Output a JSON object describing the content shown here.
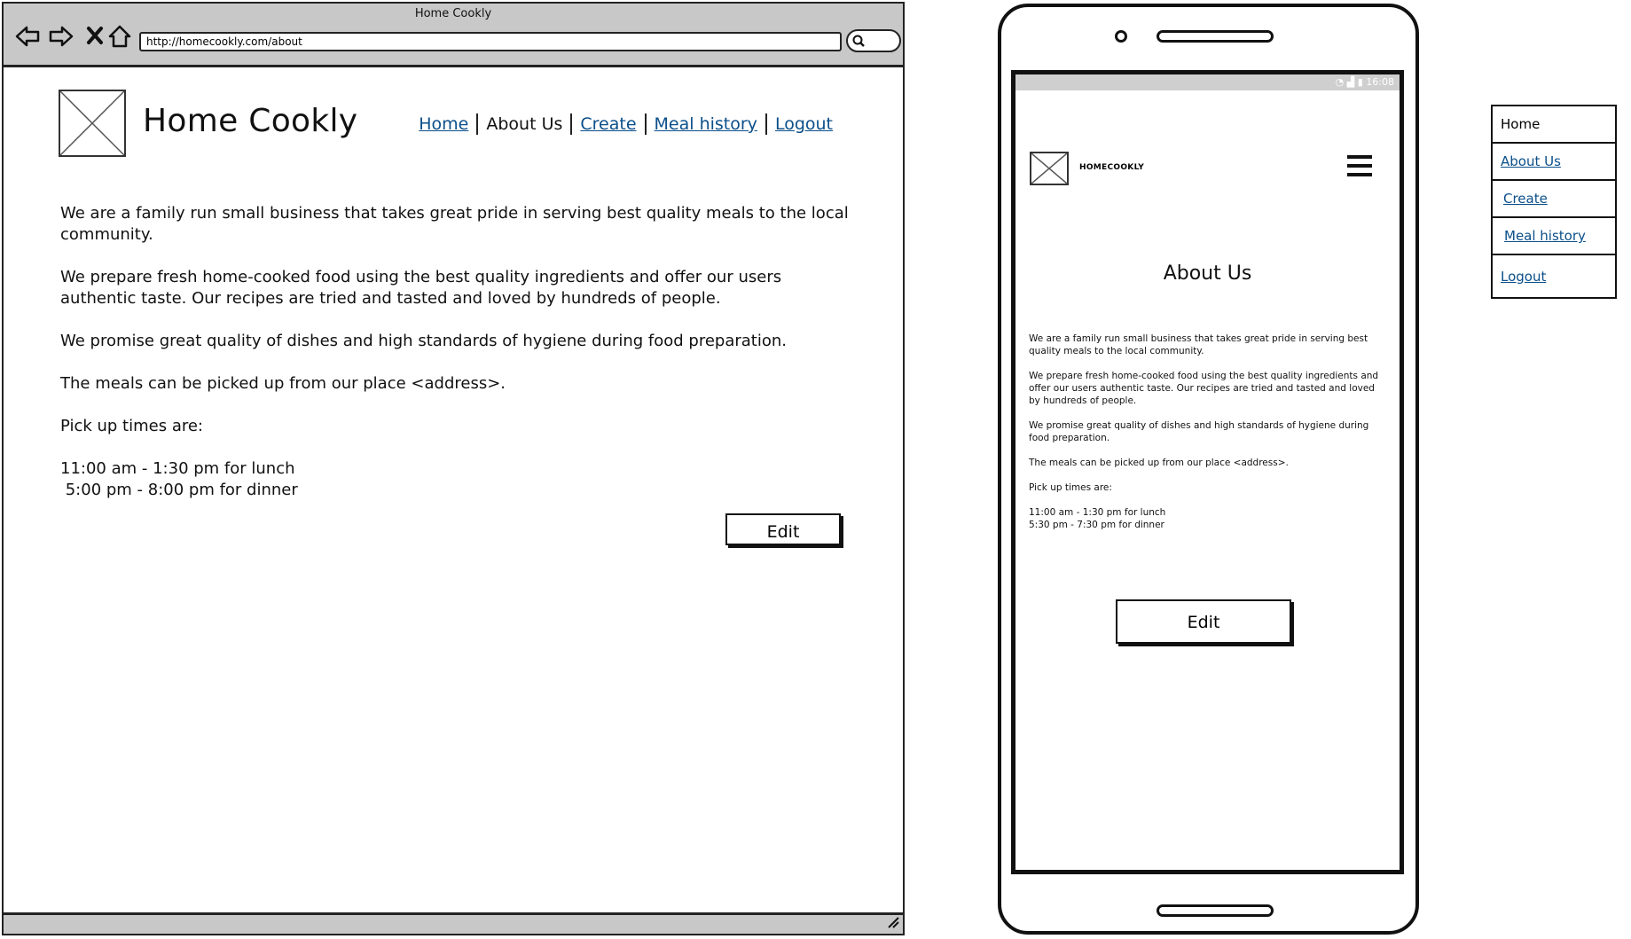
{
  "desktop": {
    "window_title": "Home Cookly",
    "url": "http://homecookly.com/about",
    "site_title": "Home Cookly",
    "nav": [
      {
        "label": "Home",
        "link": true
      },
      {
        "label": "About Us",
        "link": false
      },
      {
        "label": "Create",
        "link": true
      },
      {
        "label": "Meal history",
        "link": true
      },
      {
        "label": "Logout",
        "link": true
      }
    ],
    "paragraphs": [
      "We are a family run small business that takes great pride in serving best quality meals to the local community.",
      "We prepare fresh home-cooked food using the best quality ingredients and offer our users authentic taste. Our recipes are tried and tasted and loved by hundreds of people.",
      "We promise great quality of dishes and high standards of hygiene during food preparation.",
      "The meals can be picked up from our place <address>.",
      "Pick up times are:"
    ],
    "times": [
      "11:00 am - 1:30 pm for lunch",
      " 5:00 pm - 8:00 pm for dinner"
    ],
    "edit_label": "Edit",
    "icons": [
      "back-arrow-icon",
      "forward-arrow-icon",
      "close-icon",
      "home-icon",
      "search-icon",
      "resize-grip-icon"
    ]
  },
  "mobile": {
    "status_time": "16:08",
    "brand": "HOMECOOKLY",
    "heading": "About Us",
    "paragraphs": [
      "We are a family run small business that takes great pride in serving best quality meals to the local community.",
      "We prepare fresh home-cooked food using the best quality ingredients and offer our users authentic taste. Our recipes are tried and tasted and loved by hundreds of people.",
      "We promise great quality of dishes and high standards of hygiene during food preparation.",
      "The meals can be picked up from our place <address>.",
      "Pick up times are:"
    ],
    "times": [
      "11:00 am - 1:30 pm for lunch",
      "5:30 pm - 7:30 pm for dinner"
    ],
    "edit_label": "Edit",
    "icons": [
      "hamburger-menu-icon",
      "wifi-icon",
      "signal-icon",
      "battery-icon"
    ]
  },
  "side_menu": {
    "items": [
      {
        "label": "Home",
        "link": false
      },
      {
        "label": "About Us",
        "link": true
      },
      {
        "label": "Create",
        "link": true
      },
      {
        "label": "Meal history",
        "link": true
      },
      {
        "label": "Logout",
        "link": true
      }
    ]
  }
}
